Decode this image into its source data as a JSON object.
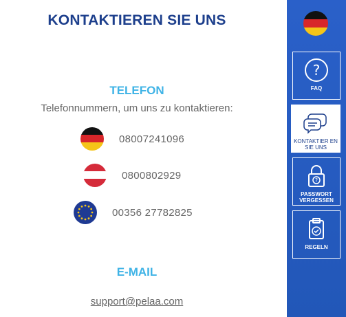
{
  "page_title": "KONTAKTIEREN SIE UNS",
  "phone_section": {
    "title": "TELEFON",
    "subtitle": "Telefonnummern, um uns zu kontaktieren:",
    "entries": [
      {
        "flag": "germany-flag-icon",
        "number": "08007241096"
      },
      {
        "flag": "austria-flag-icon",
        "number": "0800802929"
      },
      {
        "flag": "eu-flag-icon",
        "number": "00356 27782825"
      }
    ]
  },
  "email_section": {
    "title": "E-MAIL",
    "address": "support@pelaa.com"
  },
  "sidebar": {
    "language_flag": "germany-flag-icon",
    "items": [
      {
        "label": "FAQ",
        "icon": "question-icon"
      },
      {
        "label": "KONTAKTIER EN SIE UNS",
        "icon": "chat-icon",
        "active": true
      },
      {
        "label": "PASSWORT VERGESSEN",
        "icon": "lock-icon"
      },
      {
        "label": "REGELN",
        "icon": "clipboard-check-icon"
      }
    ]
  },
  "colors": {
    "title_blue": "#1d3f8c",
    "accent_cyan": "#3fb3e6",
    "sidebar_blue": "#2a60c9"
  }
}
